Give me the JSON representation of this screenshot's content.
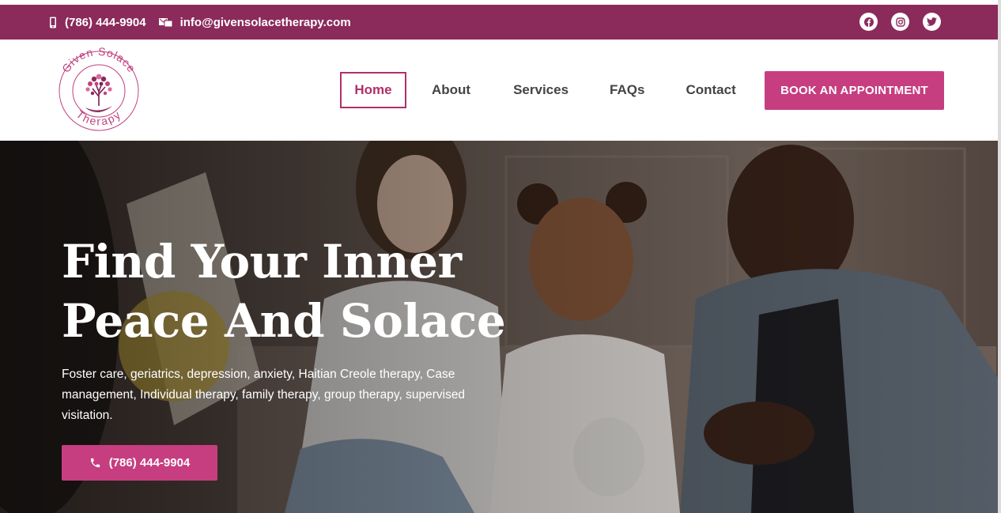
{
  "topbar": {
    "phone": "(786) 444-9904",
    "email": "info@givensolacetherapy.com",
    "socials": [
      "facebook-icon",
      "instagram-icon",
      "twitter-icon"
    ]
  },
  "logo": {
    "line1": "Given Solace",
    "line2": "Therapy"
  },
  "nav": {
    "items": [
      {
        "label": "Home",
        "active": true
      },
      {
        "label": "About"
      },
      {
        "label": "Services"
      },
      {
        "label": "FAQs"
      },
      {
        "label": "Contact"
      }
    ],
    "cta": "BOOK AN APPOINTMENT"
  },
  "hero": {
    "title_line1": "Find Your Inner",
    "title_line2": "Peace And Solace",
    "description": "Foster care, geriatrics, depression,  anxiety, Haitian Creole therapy, Case management, Individual therapy, family therapy, group therapy, supervised visitation.",
    "button": "(786) 444-9904"
  },
  "colors": {
    "topbar": "#8b2b5b",
    "accent": "#c63e7f",
    "nav_active": "#b0306b"
  }
}
